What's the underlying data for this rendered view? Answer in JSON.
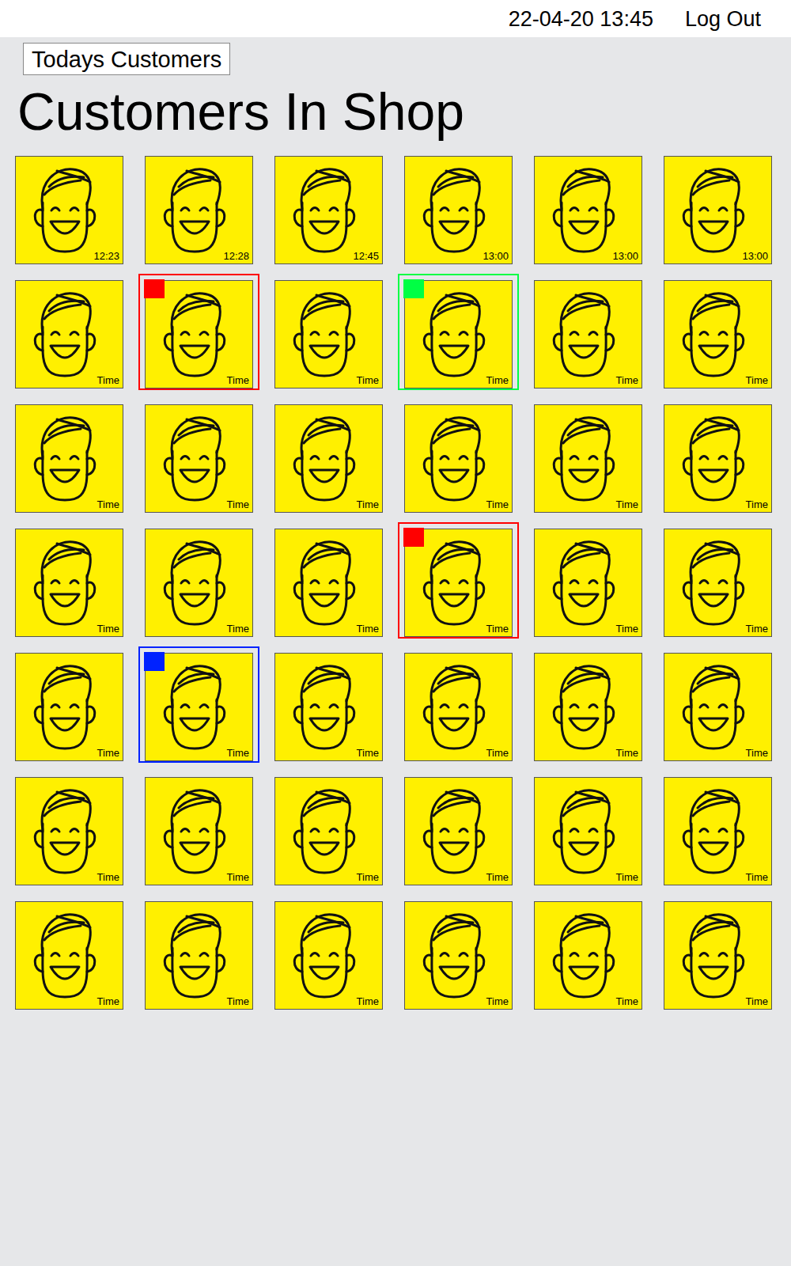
{
  "header": {
    "datetime": "22-04-20  13:45",
    "logout": "Log Out"
  },
  "todays_button": "Todays Customers",
  "heading": "Customers In Shop",
  "customers": [
    {
      "time": "12:23",
      "flagged": false
    },
    {
      "time": "12:28",
      "flagged": false
    },
    {
      "time": "12:45",
      "flagged": false
    },
    {
      "time": "13:00",
      "flagged": false
    },
    {
      "time": "13:00",
      "flagged": false
    },
    {
      "time": "13:00",
      "flagged": false
    },
    {
      "time": "Time",
      "flagged": false
    },
    {
      "time": "Time",
      "flagged": true,
      "color": "#ff0000"
    },
    {
      "time": "Time",
      "flagged": false
    },
    {
      "time": "Time",
      "flagged": true,
      "color": "#00ff44"
    },
    {
      "time": "Time",
      "flagged": false
    },
    {
      "time": "Time",
      "flagged": false
    },
    {
      "time": "Time",
      "flagged": false
    },
    {
      "time": "Time",
      "flagged": false
    },
    {
      "time": "Time",
      "flagged": false
    },
    {
      "time": "Time",
      "flagged": false
    },
    {
      "time": "Time",
      "flagged": false
    },
    {
      "time": "Time",
      "flagged": false
    },
    {
      "time": "Time",
      "flagged": false
    },
    {
      "time": "Time",
      "flagged": false
    },
    {
      "time": "Time",
      "flagged": false
    },
    {
      "time": "Time",
      "flagged": true,
      "color": "#ff0000"
    },
    {
      "time": "Time",
      "flagged": false
    },
    {
      "time": "Time",
      "flagged": false
    },
    {
      "time": "Time",
      "flagged": false
    },
    {
      "time": "Time",
      "flagged": true,
      "color": "#0022ff"
    },
    {
      "time": "Time",
      "flagged": false
    },
    {
      "time": "Time",
      "flagged": false
    },
    {
      "time": "Time",
      "flagged": false
    },
    {
      "time": "Time",
      "flagged": false
    },
    {
      "time": "Time",
      "flagged": false
    },
    {
      "time": "Time",
      "flagged": false
    },
    {
      "time": "Time",
      "flagged": false
    },
    {
      "time": "Time",
      "flagged": false
    },
    {
      "time": "Time",
      "flagged": false
    },
    {
      "time": "Time",
      "flagged": false
    },
    {
      "time": "Time",
      "flagged": false
    },
    {
      "time": "Time",
      "flagged": false
    },
    {
      "time": "Time",
      "flagged": false
    },
    {
      "time": "Time",
      "flagged": false
    },
    {
      "time": "Time",
      "flagged": false
    },
    {
      "time": "Time",
      "flagged": false
    }
  ]
}
